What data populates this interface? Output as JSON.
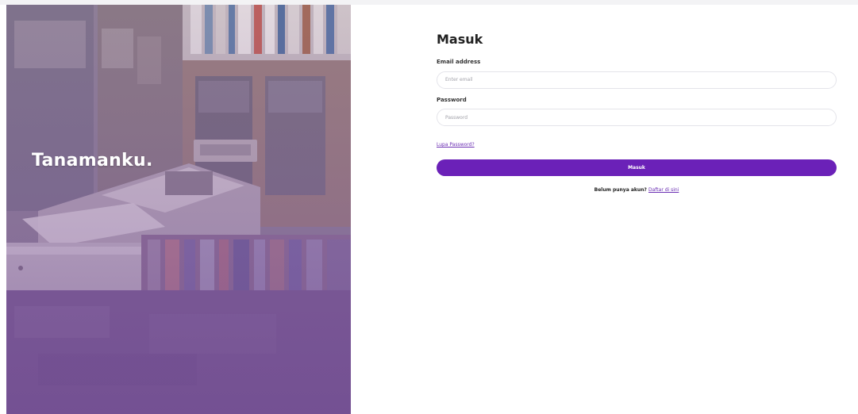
{
  "hero": {
    "brand": "Tanamanku."
  },
  "login": {
    "title": "Masuk",
    "email_label": "Email address",
    "email_placeholder": "Enter email",
    "email_value": "",
    "password_label": "Password",
    "password_placeholder": "Password",
    "password_value": "",
    "forgot_label": "Lupa Password?",
    "submit_label": "Masuk",
    "no_account_text": "Belum punya akun?",
    "signup_label": "Daftar di sini"
  },
  "colors": {
    "accent": "#6b21b8",
    "link": "#6b2fb3",
    "hero_tint": "#7a5a92"
  },
  "icons": {
    "hero_image": "bookstore-counter-photo"
  }
}
